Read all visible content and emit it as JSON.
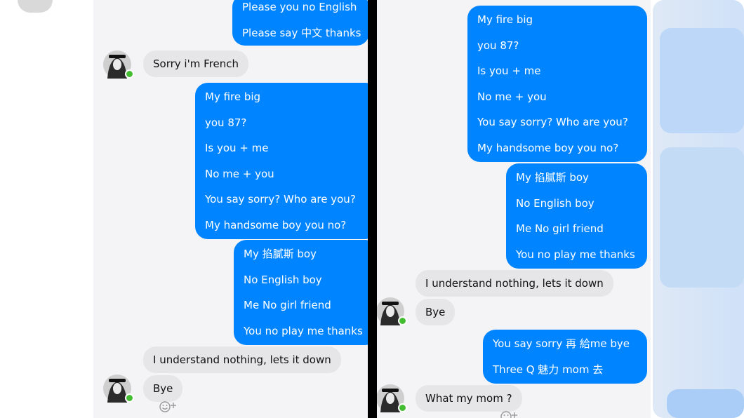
{
  "colors": {
    "outgoing": "#0084ff",
    "incoming": "#e6e6e8",
    "online": "#44bd32",
    "divider": "#000000"
  },
  "left_panel": {
    "top_bubble": [
      "Please you no English",
      "Please say 中文 thanks"
    ],
    "french_msg": "Sorry i'm French",
    "block1": [
      "My fire big",
      "you 87?",
      "Is you + me",
      "No me + you",
      "You say sorry? Who are you?",
      "My handsome boy you no?"
    ],
    "block2": [
      "My  掐膩斯 boy",
      "No English boy",
      "Me No girl friend",
      "You no play me thanks"
    ],
    "understand_msg": "I understand nothing, lets it down",
    "bye_msg": "Bye"
  },
  "right_panel": {
    "block1": [
      "My fire big",
      "you 87?",
      "Is you + me",
      "No me + you",
      "You say sorry? Who are you?",
      "My handsome boy you no?"
    ],
    "block2": [
      "My  掐膩斯 boy",
      "No English boy",
      "Me No girl friend",
      "You no play me thanks"
    ],
    "understand_msg": "I understand nothing, lets it down",
    "bye_msg": "Bye",
    "block3": [
      "You say sorry 再 給me bye",
      "Three Q 魅力 mom 去"
    ],
    "mom_msg": "What my mom ?"
  },
  "icons": {
    "avatar": "avatar-icon",
    "reaction": "add-reaction-icon"
  }
}
